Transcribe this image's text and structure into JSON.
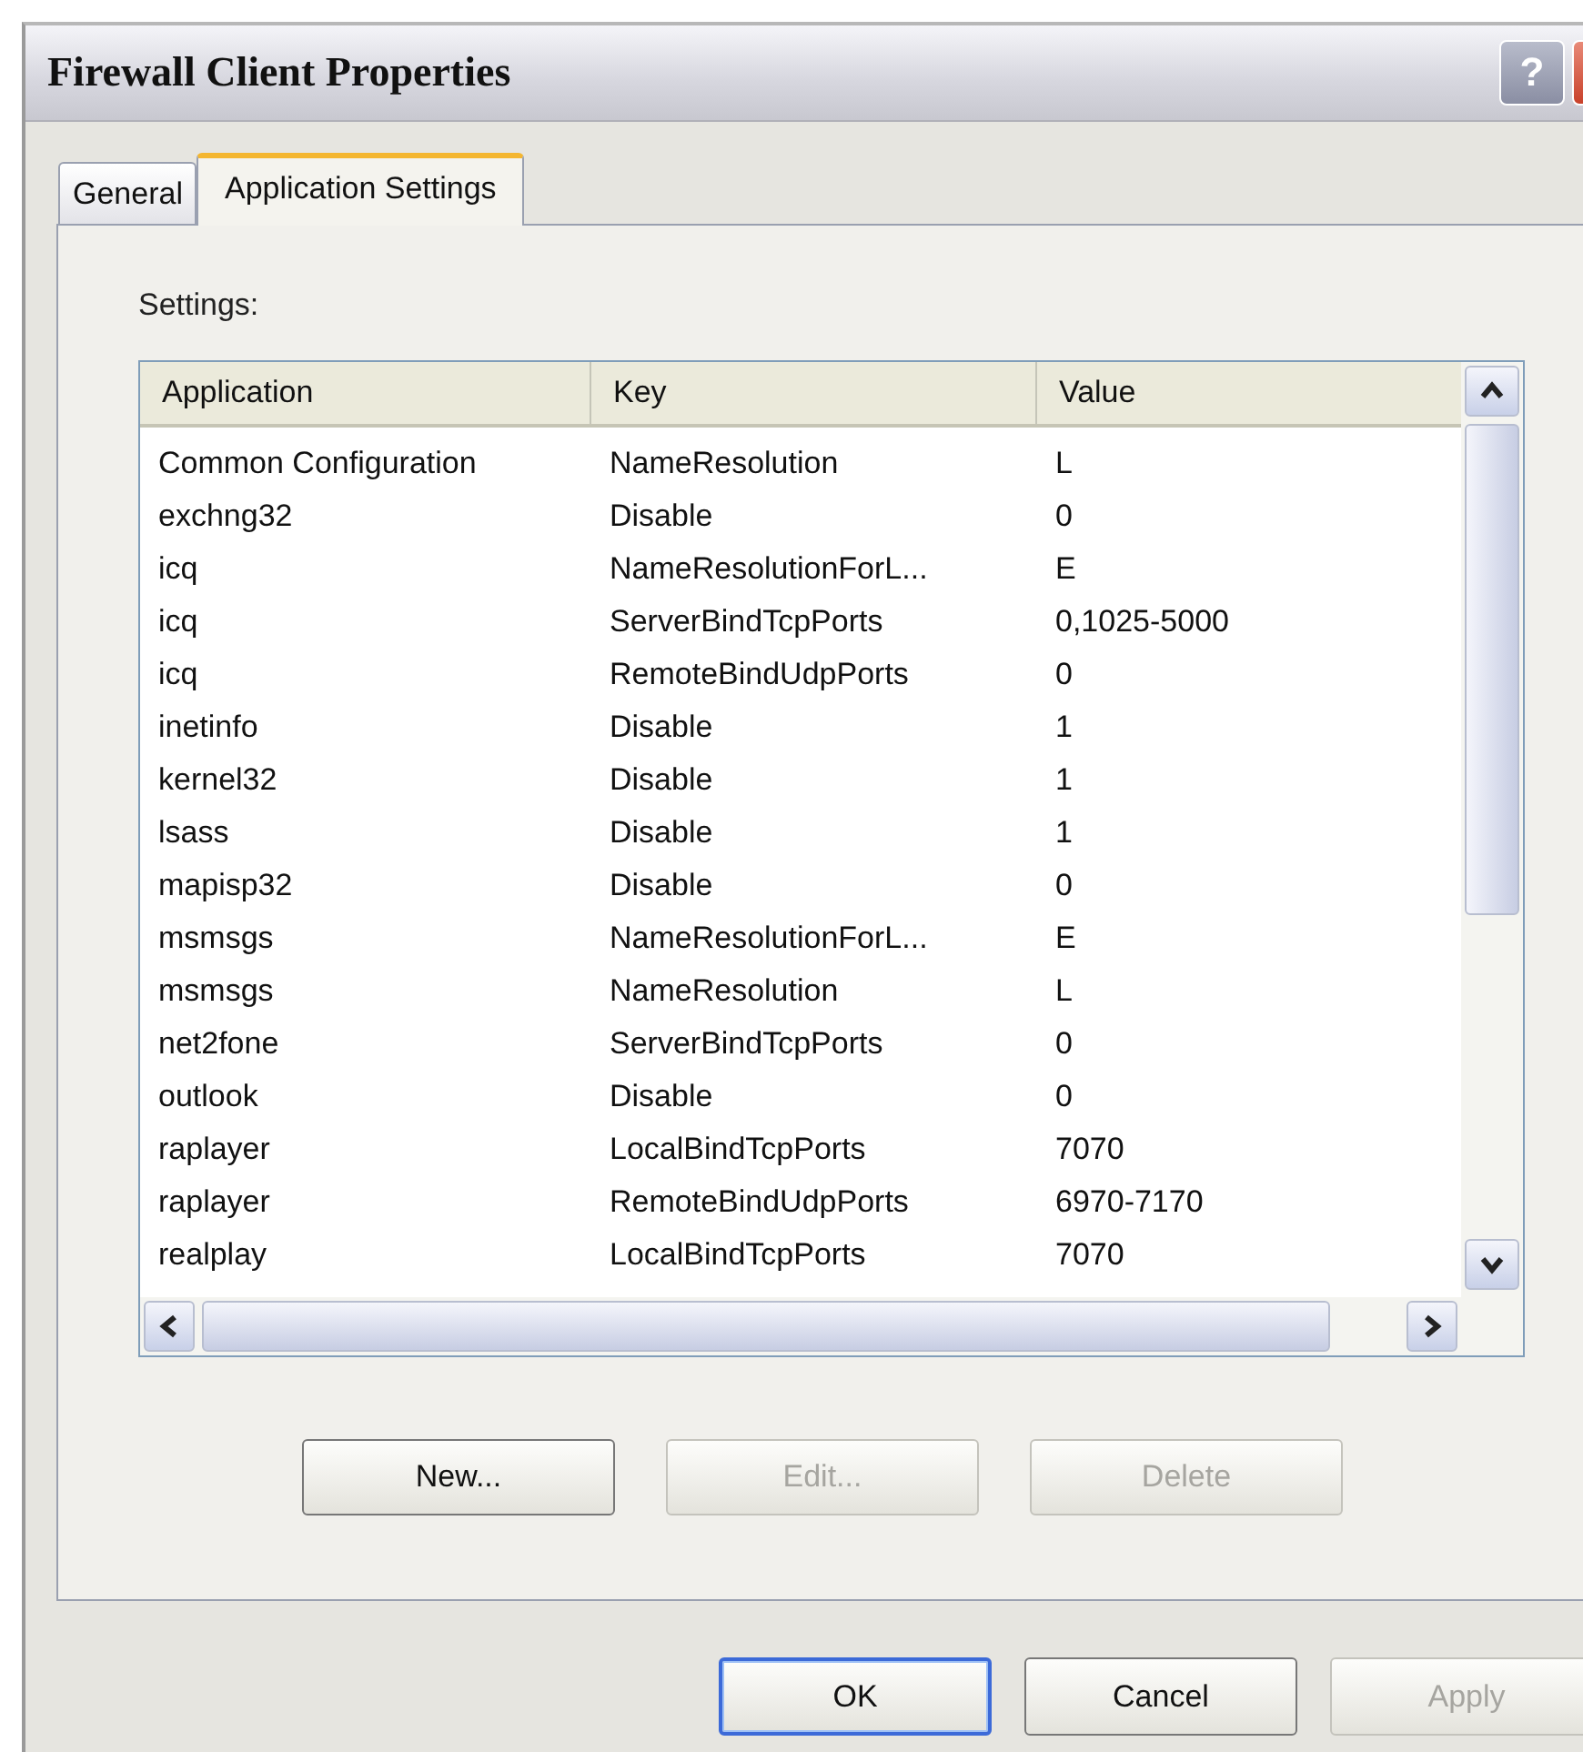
{
  "window": {
    "title": "Firewall Client Properties",
    "help_label": "?"
  },
  "tabs": [
    {
      "label": "General",
      "selected": false
    },
    {
      "label": "Application Settings",
      "selected": true
    }
  ],
  "settings_label": "Settings:",
  "table": {
    "columns": [
      "Application",
      "Key",
      "Value"
    ],
    "rows": [
      [
        "Common Configuration",
        "NameResolution",
        "L"
      ],
      [
        "exchng32",
        "Disable",
        "0"
      ],
      [
        "icq",
        "NameResolutionForL...",
        "E"
      ],
      [
        "icq",
        "ServerBindTcpPorts",
        "0,1025-5000"
      ],
      [
        "icq",
        "RemoteBindUdpPorts",
        "0"
      ],
      [
        "inetinfo",
        "Disable",
        "1"
      ],
      [
        "kernel32",
        "Disable",
        "1"
      ],
      [
        "lsass",
        "Disable",
        "1"
      ],
      [
        "mapisp32",
        "Disable",
        "0"
      ],
      [
        "msmsgs",
        "NameResolutionForL...",
        "E"
      ],
      [
        "msmsgs",
        "NameResolution",
        "L"
      ],
      [
        "net2fone",
        "ServerBindTcpPorts",
        "0"
      ],
      [
        "outlook",
        "Disable",
        "0"
      ],
      [
        "raplayer",
        "LocalBindTcpPorts",
        "7070"
      ],
      [
        "raplayer",
        "RemoteBindUdpPorts",
        "6970-7170"
      ],
      [
        "realplay",
        "LocalBindTcpPorts",
        "7070"
      ]
    ]
  },
  "list_buttons": [
    {
      "label": "New...",
      "disabled": false
    },
    {
      "label": "Edit...",
      "disabled": true
    },
    {
      "label": "Delete",
      "disabled": true
    }
  ],
  "dialog_buttons": [
    {
      "label": "OK",
      "disabled": false,
      "default": true
    },
    {
      "label": "Cancel",
      "disabled": false,
      "default": false
    },
    {
      "label": "Apply",
      "disabled": true,
      "default": false
    }
  ]
}
